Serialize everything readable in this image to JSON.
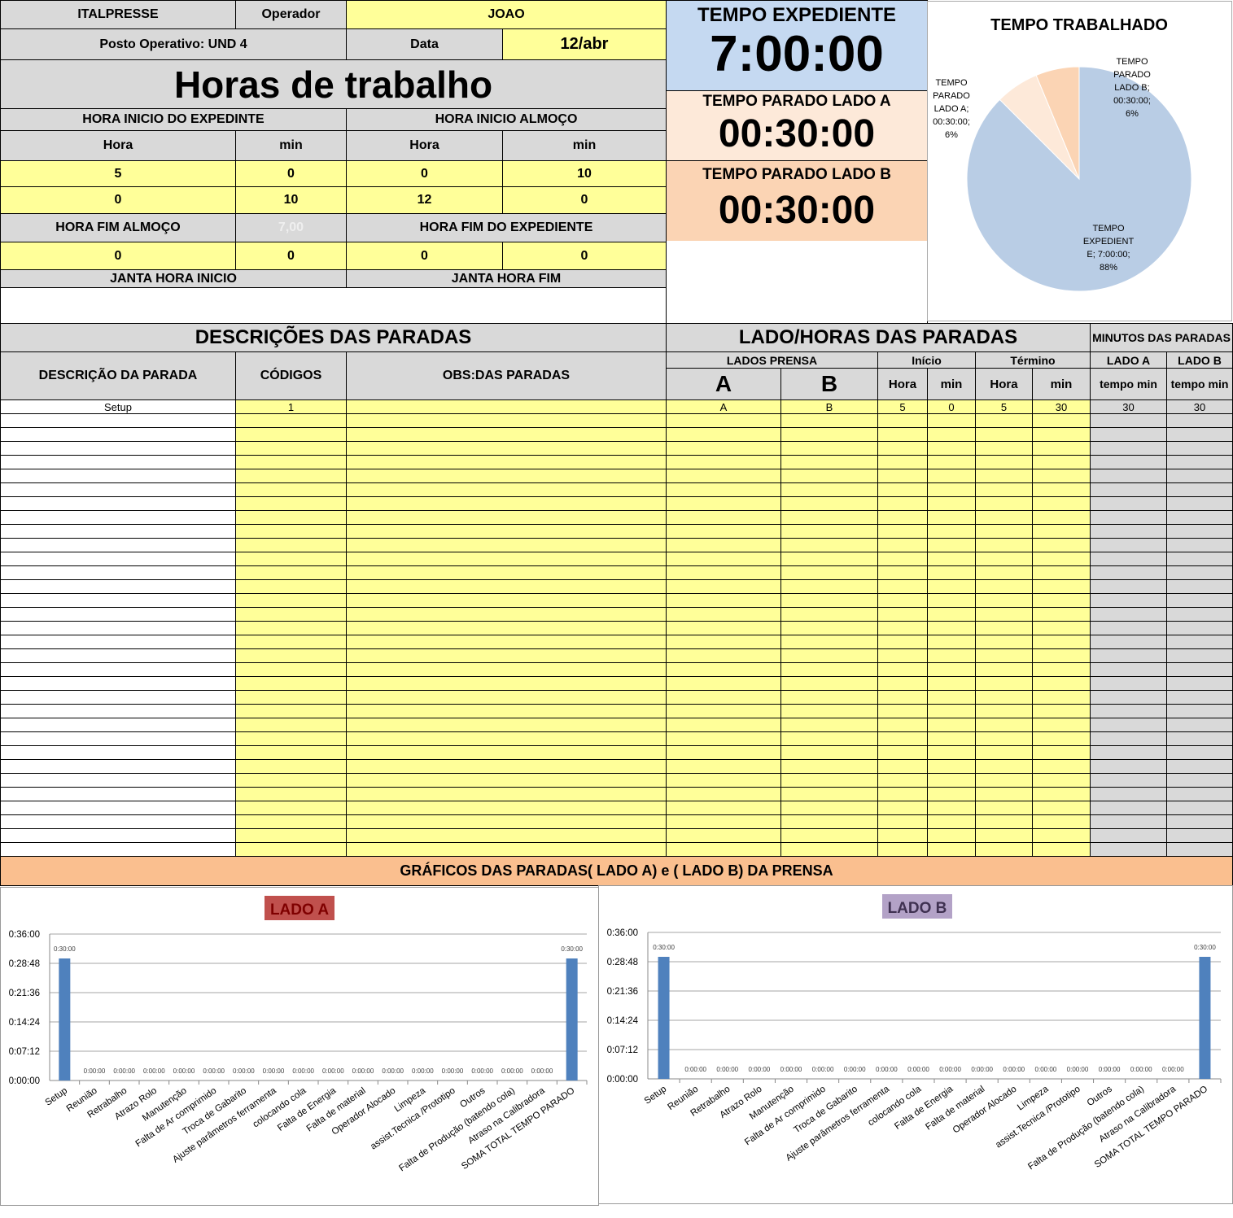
{
  "header": {
    "company": "ITALPRESSE",
    "operator_label": "Operador",
    "operator_value": "JOAO",
    "post": "Posto Operativo: UND 4",
    "date_label": "Data",
    "date_value": "12/abr",
    "title": "Horas de trabalho"
  },
  "schedule": {
    "start_label": "HORA INICIO DO EXPEDINTE",
    "lunch_start_label": "HORA INICIO ALMOÇO",
    "hora": "Hora",
    "min": "min",
    "row1": [
      "5",
      "0",
      "0",
      "10"
    ],
    "row2": [
      "0",
      "10",
      "12",
      "0"
    ],
    "lunch_end_label": "HORA FIM ALMOÇO",
    "lunch_end_ghost": "7,00",
    "end_label": "HORA FIM DO EXPEDIENTE",
    "row3": [
      "0",
      "0",
      "0",
      "0"
    ],
    "dinner_start_label": "JANTA HORA INICIO",
    "dinner_end_label": "JANTA HORA FIM"
  },
  "summary": {
    "expediente_label": "TEMPO EXPEDIENTE",
    "expediente_value": "7:00:00",
    "lado_a_label": "TEMPO PARADO LADO A",
    "lado_a_value": "00:30:00",
    "lado_b_label": "TEMPO PARADO LADO B",
    "lado_b_value": "00:30:00"
  },
  "stops": {
    "section_title": "DESCRIÇÕES DAS PARADAS",
    "right_title": "LADO/HORAS DAS PARADAS",
    "minutes_title": "MINUTOS DAS PARADAS",
    "col_desc": "DESCRIÇÃO DA PARADA",
    "col_codes": "CÓDIGOS",
    "col_obs": "OBS:DAS PARADAS",
    "lados_prensa": "LADOS PRENSA",
    "col_a": "A",
    "col_b": "B",
    "inicio": "Início",
    "termino": "Término",
    "hora": "Hora",
    "min": "min",
    "lado_a": "LADO A",
    "lado_b": "LADO B",
    "tempo_min": "tempo min",
    "rows": [
      {
        "desc": "Setup",
        "code": "1",
        "obs": "",
        "a": "A",
        "b": "B",
        "ih": "5",
        "im": "0",
        "th": "5",
        "tm": "30",
        "ma": "30",
        "mb": "30"
      }
    ],
    "empty_rows": 32
  },
  "charts_banner": "GRÁFICOS DAS PARADAS( LADO A) e ( LADO B) DA PRENSA",
  "chart_data": [
    {
      "type": "pie",
      "title": "TEMPO TRABALHADO",
      "slices": [
        {
          "name": "TEMPO EXPEDIENTE",
          "label": "TEMPO EXPEDIENTE; 7:00:00; 88%",
          "value": 420,
          "percent": 88,
          "color": "#b9cde5"
        },
        {
          "name": "TEMPO PARADO LADO A",
          "label": "TEMPO PARADO LADO A; 00:30:00; 6%",
          "value": 30,
          "percent": 6,
          "color": "#fde9d9"
        },
        {
          "name": "TEMPO PARADO LADO B",
          "label": "TEMPO PARADO LADO B; 00:30:00; 6%",
          "value": 30,
          "percent": 6,
          "color": "#fbd4b4"
        }
      ]
    },
    {
      "type": "bar",
      "title": "LADO A",
      "title_bg": "#c0504d",
      "bar_color": "#4f81bd",
      "ylim": [
        0,
        36
      ],
      "yticks": [
        "0:00:00",
        "0:07:12",
        "0:14:24",
        "0:21:36",
        "0:28:48",
        "0:36:00"
      ],
      "categories": [
        "Setup",
        "Reunião",
        "Retrabalho",
        "Atrazo Rolo",
        "Manutenção",
        "Falta de Ar comprimido",
        "Troca de Gabarito",
        "Ajuste parâmetros ferramenta",
        "colocando cola",
        "Falta de Energia",
        "Falta de material",
        "Operador Alocado",
        "Limpeza",
        "assist.Tecnica /Prototipo",
        "Outros",
        "Falta de Produção (batendo cola)",
        "Atraso na Calibradora",
        "SOMA TOTAL TEMPO PARADO"
      ],
      "values": [
        30,
        0,
        0,
        0,
        0,
        0,
        0,
        0,
        0,
        0,
        0,
        0,
        0,
        0,
        0,
        0,
        0,
        30
      ],
      "value_labels": [
        "0:30:00",
        "0:00:00",
        "0:00:00",
        "0:00:00",
        "0:00:00",
        "0:00:00",
        "0:00:00",
        "0:00:00",
        "0:00:00",
        "0:00:00",
        "0:00:00",
        "0:00:00",
        "0:00:00",
        "0:00:00",
        "0:00:00",
        "0:00:00",
        "0:00:00",
        "0:30:00"
      ],
      "grid": true
    },
    {
      "type": "bar",
      "title": "LADO B",
      "title_bg": "#b3a2c7",
      "bar_color": "#4f81bd",
      "ylim": [
        0,
        36
      ],
      "yticks": [
        "0:00:00",
        "0:07:12",
        "0:14:24",
        "0:21:36",
        "0:28:48",
        "0:36:00"
      ],
      "categories": [
        "Setup",
        "Reunião",
        "Retrabalho",
        "Atrazo Rolo",
        "Manutenção",
        "Falta de Ar comprimido",
        "Troca de Gabarito",
        "Ajuste parâmetros ferramenta",
        "colocando cola",
        "Falta de Energia",
        "Falta de material",
        "Operador Alocado",
        "Limpeza",
        "assist.Tecnica /Prototipo",
        "Outros",
        "Falta de Produção (batendo cola)",
        "Atraso na Calibradora",
        "SOMA TOTAL TEMPO PARADO"
      ],
      "values": [
        30,
        0,
        0,
        0,
        0,
        0,
        0,
        0,
        0,
        0,
        0,
        0,
        0,
        0,
        0,
        0,
        0,
        30
      ],
      "value_labels": [
        "0:30:00",
        "0:00:00",
        "0:00:00",
        "0:00:00",
        "0:00:00",
        "0:00:00",
        "0:00:00",
        "0:00:00",
        "0:00:00",
        "0:00:00",
        "0:00:00",
        "0:00:00",
        "0:00:00",
        "0:00:00",
        "0:00:00",
        "0:00:00",
        "0:00:00",
        "0:30:00"
      ],
      "grid": true
    }
  ]
}
